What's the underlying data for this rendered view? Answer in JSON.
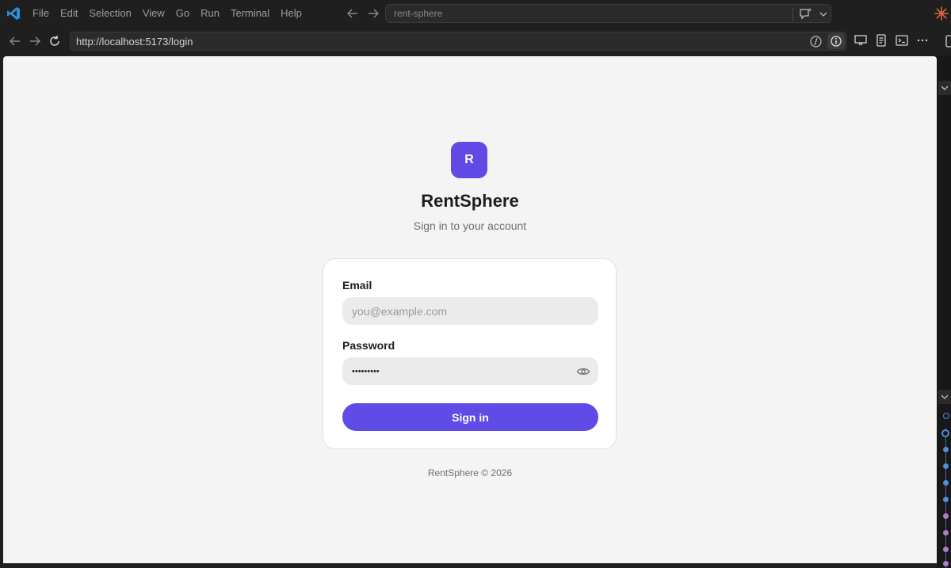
{
  "titlebar": {
    "menu": [
      "File",
      "Edit",
      "Selection",
      "View",
      "Go",
      "Run",
      "Terminal",
      "Help"
    ],
    "search_text": "rent-sphere"
  },
  "browser": {
    "url": "http://localhost:5173/login"
  },
  "login": {
    "logo_letter": "R",
    "app_name": "RentSphere",
    "subtitle": "Sign in to your account",
    "email_label": "Email",
    "email_placeholder": "you@example.com",
    "password_label": "Password",
    "password_value": "•••••••••",
    "signin_label": "Sign in",
    "footer": "RentSphere © 2026"
  },
  "colors": {
    "accent": "#5f4be6",
    "page_bg": "#f4f4f4",
    "editor_bg": "#1f1f1f"
  },
  "icons": {
    "titlebar": [
      "vscode-logo-icon",
      "back-arrow-icon",
      "forward-arrow-icon",
      "chat-sparkle-icon",
      "chevron-down-icon",
      "sparkle-icon"
    ],
    "browser": [
      "back-icon",
      "forward-icon",
      "reload-icon",
      "code-icon",
      "info-icon",
      "screen-icon",
      "notes-icon",
      "terminal-icon",
      "more-icon"
    ],
    "form": [
      "eye-icon"
    ]
  }
}
